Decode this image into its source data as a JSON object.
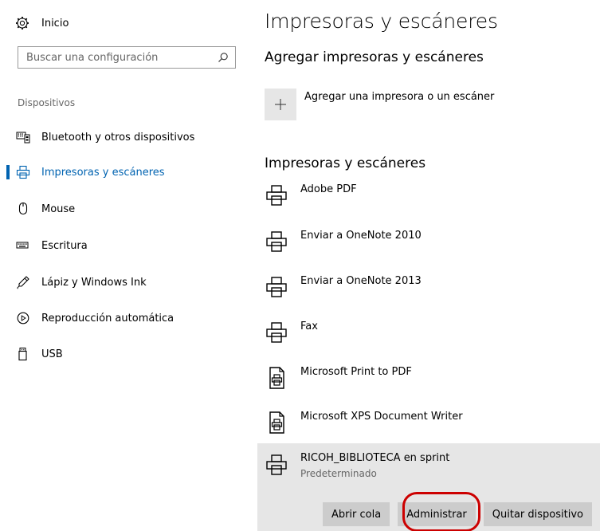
{
  "sidebar": {
    "home_label": "Inicio",
    "search_placeholder": "Buscar una configuración",
    "section_label": "Dispositivos",
    "items": [
      {
        "label": "Bluetooth y otros dispositivos",
        "icon": "bluetooth-devices-icon"
      },
      {
        "label": "Impresoras y escáneres",
        "icon": "printer-icon",
        "active": true
      },
      {
        "label": "Mouse",
        "icon": "mouse-icon"
      },
      {
        "label": "Escritura",
        "icon": "keyboard-icon"
      },
      {
        "label": "Lápiz y Windows Ink",
        "icon": "pen-icon"
      },
      {
        "label": "Reproducción automática",
        "icon": "autoplay-icon"
      },
      {
        "label": "USB",
        "icon": "usb-icon"
      }
    ]
  },
  "main": {
    "title": "Impresoras y escáneres",
    "add_section_title": "Agregar impresoras y escáneres",
    "add_label": "Agregar una impresora o un escáner",
    "printers_title": "Impresoras y escáneres",
    "printers": [
      {
        "name": "Adobe PDF",
        "icon": "printer-icon"
      },
      {
        "name": "Enviar a OneNote 2010",
        "icon": "printer-icon"
      },
      {
        "name": "Enviar a OneNote 2013",
        "icon": "printer-icon"
      },
      {
        "name": "Fax",
        "icon": "printer-icon"
      },
      {
        "name": "Microsoft Print to PDF",
        "icon": "document-printer-icon"
      },
      {
        "name": "Microsoft XPS Document Writer",
        "icon": "document-printer-icon"
      },
      {
        "name": "RICOH_BIBLIOTECA en sprint",
        "status": "Predeterminado",
        "icon": "printer-icon",
        "selected": true
      }
    ],
    "actions": {
      "open_queue": "Abrir cola",
      "manage": "Administrar",
      "remove": "Quitar dispositivo"
    }
  },
  "colors": {
    "accent": "#0063b1",
    "highlight": "#cc0000",
    "selected_bg": "#e6e6e6",
    "button_bg": "#cccccc"
  }
}
